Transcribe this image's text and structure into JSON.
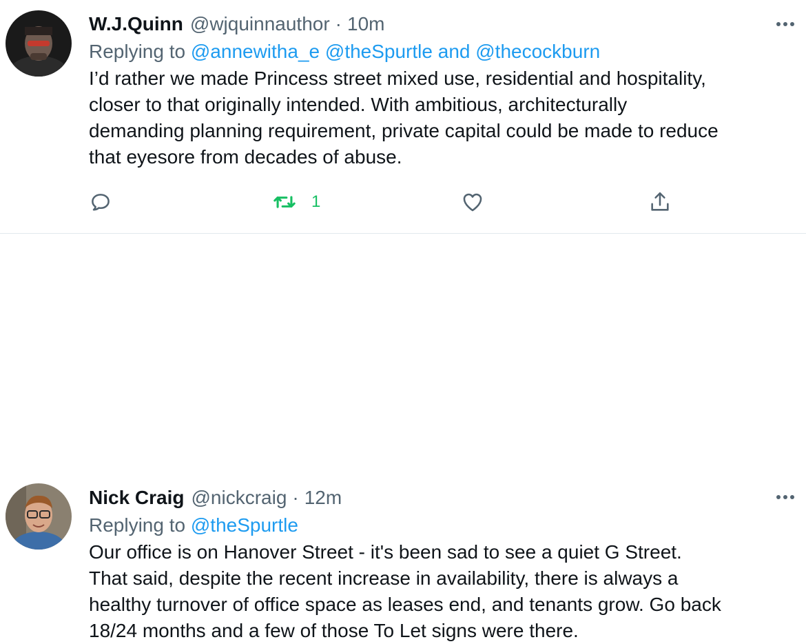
{
  "tweets": [
    {
      "name": "W.J.Quinn",
      "handle": "@wjquinnauthor",
      "separator": "·",
      "time": "10m",
      "replying_prefix": "Replying to",
      "mentions": [
        "@annewitha_e",
        "@theSpurtle",
        "@thecockburn"
      ],
      "mention_joiner": "and",
      "text_lines": [
        "I’d rather we made Princess street mixed use,  residential and hospitality,",
        "closer to that originally intended. With ambitious, architecturally",
        "demanding planning requirement, private capital could be made to reduce",
        "that eyesore from decades of abuse."
      ],
      "actions": {
        "reply_icon": "reply-icon",
        "retweet_icon": "retweet-icon",
        "retweet_count": "1",
        "like_icon": "heart-icon",
        "share_icon": "share-icon"
      }
    },
    {
      "name": "Nick Craig",
      "handle": "@nickcraig",
      "separator": "·",
      "time": "12m",
      "replying_prefix": "Replying to",
      "mentions": [
        "@theSpurtle"
      ],
      "text_lines": [
        "Our office is on Hanover Street - it's been sad to see a quiet G Street.",
        "That said, despite the recent increase in availability, there is always a",
        "healthy turnover of office space as leases end, and tenants grow. Go back",
        "18/24 months and a few of those To Let signs were there."
      ]
    }
  ],
  "colors": {
    "link": "#1d9bf0",
    "secondary_text": "#536471",
    "retweet_active": "#17bf63",
    "divider": "#e1e8ed"
  }
}
